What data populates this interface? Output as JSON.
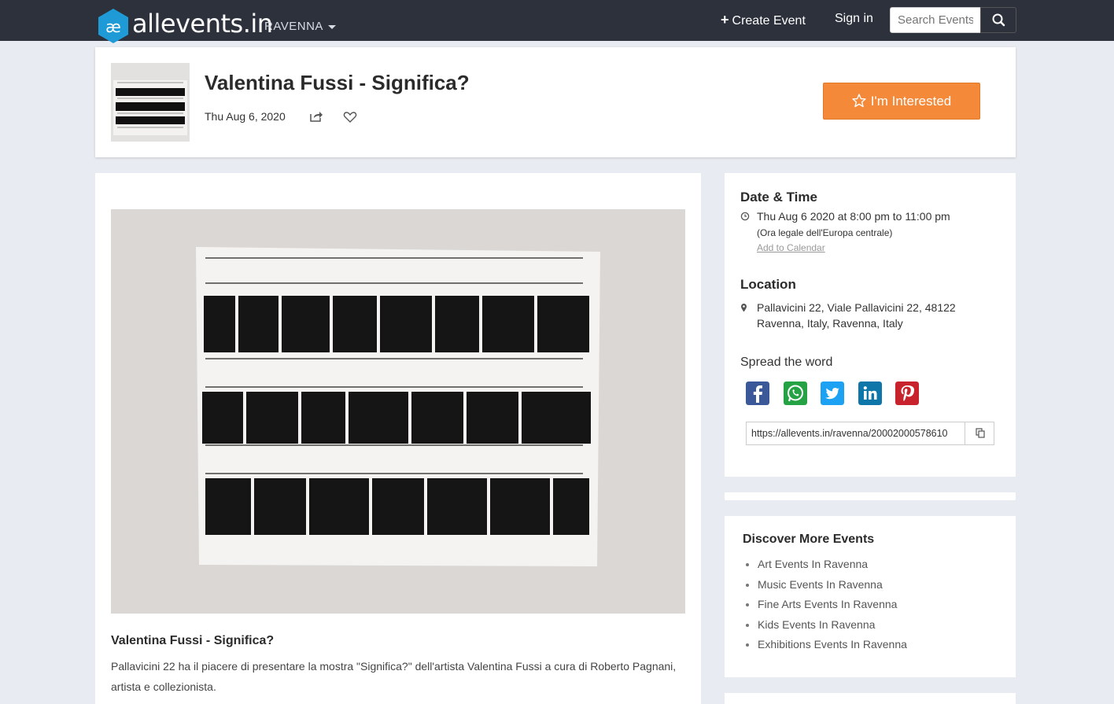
{
  "nav": {
    "brand": "allevents.in",
    "city": "RAVENNA",
    "create_event": "Create Event",
    "sign_in": "Sign in",
    "search_placeholder": "Search Events"
  },
  "event": {
    "title": "Valentina Fussi - Significa?",
    "date": "Thu Aug 6, 2020",
    "interested_label": "I'm Interested"
  },
  "description": {
    "title": "Valentina Fussi - Significa?",
    "text": "Pallavicini 22 ha il piacere di presentare la mostra \"Significa?\" dell'artista Valentina Fussi a cura di Roberto Pagnani, artista e collezionista."
  },
  "sidebar": {
    "date_heading": "Date & Time",
    "datetime": "Thu Aug 6 2020 at 8:00 pm to 11:00 pm",
    "timezone": "(Ora legale dell'Europa centrale)",
    "add_calendar": "Add to Calendar",
    "location_heading": "Location",
    "address_line1": "Pallavicini 22, Viale Pallavicini 22, 48122",
    "address_line2": "Ravenna, Italy, Ravenna, Italy",
    "spread_heading": "Spread the word",
    "share_url": "https://allevents.in/ravenna/20002000578610"
  },
  "social": [
    {
      "name": "facebook",
      "color": "#3b5998"
    },
    {
      "name": "whatsapp",
      "color": "#25a244"
    },
    {
      "name": "twitter",
      "color": "#1da1f2"
    },
    {
      "name": "linkedin",
      "color": "#0e76a8"
    },
    {
      "name": "pinterest",
      "color": "#c8232c"
    }
  ],
  "discover": {
    "heading": "Discover More Events",
    "items": [
      "Art Events In Ravenna",
      "Music Events In Ravenna",
      "Fine Arts Events In Ravenna",
      "Kids Events In Ravenna",
      "Exhibitions Events In Ravenna"
    ]
  },
  "colors": {
    "nav_bg": "#2c313c",
    "accent_orange": "#f5893a",
    "logo_blue": "#1e9bd7",
    "page_bg": "#e9ebf2"
  }
}
